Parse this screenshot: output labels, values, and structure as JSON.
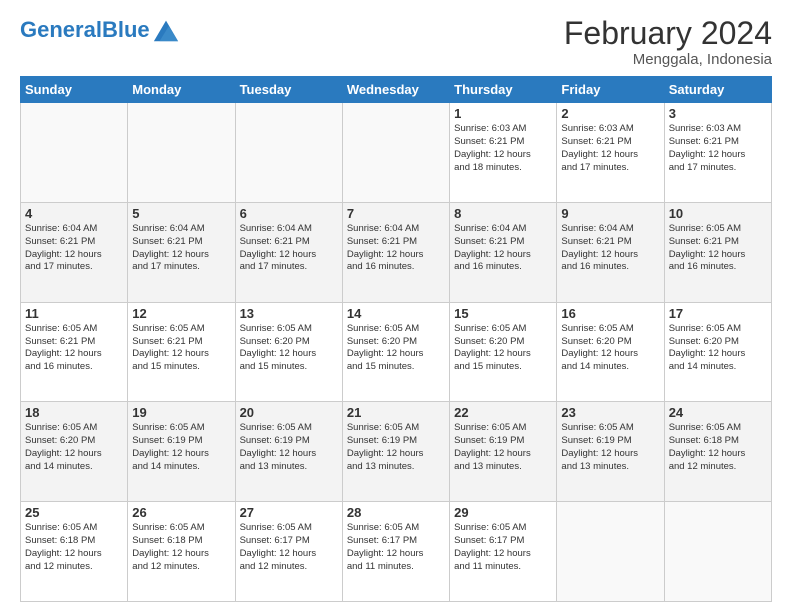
{
  "header": {
    "logo_general": "General",
    "logo_blue": "Blue",
    "month_title": "February 2024",
    "location": "Menggala, Indonesia"
  },
  "days_of_week": [
    "Sunday",
    "Monday",
    "Tuesday",
    "Wednesday",
    "Thursday",
    "Friday",
    "Saturday"
  ],
  "weeks": [
    {
      "days": [
        {
          "num": "",
          "info": "",
          "empty": true
        },
        {
          "num": "",
          "info": "",
          "empty": true
        },
        {
          "num": "",
          "info": "",
          "empty": true
        },
        {
          "num": "",
          "info": "",
          "empty": true
        },
        {
          "num": "1",
          "info": "Sunrise: 6:03 AM\nSunset: 6:21 PM\nDaylight: 12 hours\nand 18 minutes.",
          "empty": false
        },
        {
          "num": "2",
          "info": "Sunrise: 6:03 AM\nSunset: 6:21 PM\nDaylight: 12 hours\nand 17 minutes.",
          "empty": false
        },
        {
          "num": "3",
          "info": "Sunrise: 6:03 AM\nSunset: 6:21 PM\nDaylight: 12 hours\nand 17 minutes.",
          "empty": false
        }
      ]
    },
    {
      "days": [
        {
          "num": "4",
          "info": "Sunrise: 6:04 AM\nSunset: 6:21 PM\nDaylight: 12 hours\nand 17 minutes.",
          "empty": false
        },
        {
          "num": "5",
          "info": "Sunrise: 6:04 AM\nSunset: 6:21 PM\nDaylight: 12 hours\nand 17 minutes.",
          "empty": false
        },
        {
          "num": "6",
          "info": "Sunrise: 6:04 AM\nSunset: 6:21 PM\nDaylight: 12 hours\nand 17 minutes.",
          "empty": false
        },
        {
          "num": "7",
          "info": "Sunrise: 6:04 AM\nSunset: 6:21 PM\nDaylight: 12 hours\nand 16 minutes.",
          "empty": false
        },
        {
          "num": "8",
          "info": "Sunrise: 6:04 AM\nSunset: 6:21 PM\nDaylight: 12 hours\nand 16 minutes.",
          "empty": false
        },
        {
          "num": "9",
          "info": "Sunrise: 6:04 AM\nSunset: 6:21 PM\nDaylight: 12 hours\nand 16 minutes.",
          "empty": false
        },
        {
          "num": "10",
          "info": "Sunrise: 6:05 AM\nSunset: 6:21 PM\nDaylight: 12 hours\nand 16 minutes.",
          "empty": false
        }
      ]
    },
    {
      "days": [
        {
          "num": "11",
          "info": "Sunrise: 6:05 AM\nSunset: 6:21 PM\nDaylight: 12 hours\nand 16 minutes.",
          "empty": false
        },
        {
          "num": "12",
          "info": "Sunrise: 6:05 AM\nSunset: 6:21 PM\nDaylight: 12 hours\nand 15 minutes.",
          "empty": false
        },
        {
          "num": "13",
          "info": "Sunrise: 6:05 AM\nSunset: 6:20 PM\nDaylight: 12 hours\nand 15 minutes.",
          "empty": false
        },
        {
          "num": "14",
          "info": "Sunrise: 6:05 AM\nSunset: 6:20 PM\nDaylight: 12 hours\nand 15 minutes.",
          "empty": false
        },
        {
          "num": "15",
          "info": "Sunrise: 6:05 AM\nSunset: 6:20 PM\nDaylight: 12 hours\nand 15 minutes.",
          "empty": false
        },
        {
          "num": "16",
          "info": "Sunrise: 6:05 AM\nSunset: 6:20 PM\nDaylight: 12 hours\nand 14 minutes.",
          "empty": false
        },
        {
          "num": "17",
          "info": "Sunrise: 6:05 AM\nSunset: 6:20 PM\nDaylight: 12 hours\nand 14 minutes.",
          "empty": false
        }
      ]
    },
    {
      "days": [
        {
          "num": "18",
          "info": "Sunrise: 6:05 AM\nSunset: 6:20 PM\nDaylight: 12 hours\nand 14 minutes.",
          "empty": false
        },
        {
          "num": "19",
          "info": "Sunrise: 6:05 AM\nSunset: 6:19 PM\nDaylight: 12 hours\nand 14 minutes.",
          "empty": false
        },
        {
          "num": "20",
          "info": "Sunrise: 6:05 AM\nSunset: 6:19 PM\nDaylight: 12 hours\nand 13 minutes.",
          "empty": false
        },
        {
          "num": "21",
          "info": "Sunrise: 6:05 AM\nSunset: 6:19 PM\nDaylight: 12 hours\nand 13 minutes.",
          "empty": false
        },
        {
          "num": "22",
          "info": "Sunrise: 6:05 AM\nSunset: 6:19 PM\nDaylight: 12 hours\nand 13 minutes.",
          "empty": false
        },
        {
          "num": "23",
          "info": "Sunrise: 6:05 AM\nSunset: 6:19 PM\nDaylight: 12 hours\nand 13 minutes.",
          "empty": false
        },
        {
          "num": "24",
          "info": "Sunrise: 6:05 AM\nSunset: 6:18 PM\nDaylight: 12 hours\nand 12 minutes.",
          "empty": false
        }
      ]
    },
    {
      "days": [
        {
          "num": "25",
          "info": "Sunrise: 6:05 AM\nSunset: 6:18 PM\nDaylight: 12 hours\nand 12 minutes.",
          "empty": false
        },
        {
          "num": "26",
          "info": "Sunrise: 6:05 AM\nSunset: 6:18 PM\nDaylight: 12 hours\nand 12 minutes.",
          "empty": false
        },
        {
          "num": "27",
          "info": "Sunrise: 6:05 AM\nSunset: 6:17 PM\nDaylight: 12 hours\nand 12 minutes.",
          "empty": false
        },
        {
          "num": "28",
          "info": "Sunrise: 6:05 AM\nSunset: 6:17 PM\nDaylight: 12 hours\nand 11 minutes.",
          "empty": false
        },
        {
          "num": "29",
          "info": "Sunrise: 6:05 AM\nSunset: 6:17 PM\nDaylight: 12 hours\nand 11 minutes.",
          "empty": false
        },
        {
          "num": "",
          "info": "",
          "empty": true
        },
        {
          "num": "",
          "info": "",
          "empty": true
        }
      ]
    }
  ]
}
